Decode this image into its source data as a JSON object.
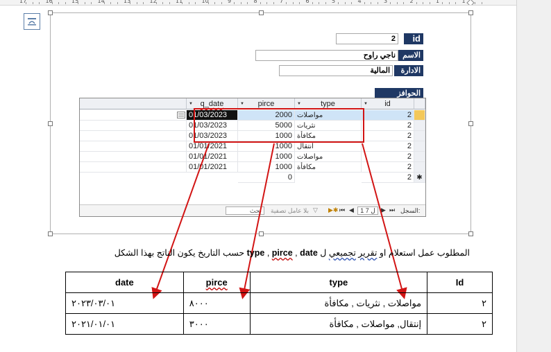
{
  "ruler": {
    "numbers": [
      "17",
      "16",
      "15",
      "14",
      "13",
      "12",
      "11",
      "10",
      "9",
      "8",
      "7",
      "6",
      "5",
      "4",
      "3",
      "2",
      "1",
      "1"
    ]
  },
  "icons": {
    "layout_options": "layout-options-icon",
    "datasheet_tools": "datasheet-button-icon"
  },
  "form": {
    "id_label": "id",
    "id_value": "2",
    "name_label": "الاسم",
    "name_value": "ناجي راوح",
    "dept_label": "الادارة",
    "dept_value": "المالية",
    "bonuses_label": "الحوافز"
  },
  "subform": {
    "columns": {
      "q_date": "q_date",
      "pirce": "pirce",
      "type": "type",
      "id": "id"
    },
    "rows": [
      {
        "q_date": "01/03/2023",
        "pirce": "2000",
        "type": "مواصلات",
        "id": "2"
      },
      {
        "q_date": "01/03/2023",
        "pirce": "5000",
        "type": "نثريات",
        "id": "2"
      },
      {
        "q_date": "01/03/2023",
        "pirce": "1000",
        "type": "مكافأة",
        "id": "2"
      },
      {
        "q_date": "01/01/2021",
        "pirce": "1000",
        "type": "انتقال",
        "id": "2"
      },
      {
        "q_date": "01/01/2021",
        "pirce": "1000",
        "type": "مواصلات",
        "id": "2"
      },
      {
        "q_date": "01/01/2021",
        "pirce": "1000",
        "type": "مكافأة",
        "id": "2"
      }
    ],
    "new_row": {
      "pirce": "0",
      "id": "2",
      "marker": "✱"
    },
    "navigation": {
      "record_label": "السجل:",
      "record_position": "1 ل 7",
      "no_filter_label": "بلا عامل تصفية",
      "search_placeholder": "بحث"
    }
  },
  "task_text": {
    "part1": "المطلوب عمل استعلام او ",
    "report": "تقرير",
    "part2": " ",
    "aggregate": "تجميعي",
    "part3": " ل  ",
    "type": "type",
    "comma1": " , ",
    "pirce": "pirce",
    "comma2": "  ,  ",
    "date": "date",
    "part4": "  حسب التاريخ  يكون الناتج بهذا الشكل"
  },
  "result_table": {
    "headers": {
      "date": "date",
      "pirce": "pirce",
      "type": "type",
      "id": "Id"
    },
    "rows": [
      {
        "date": "٢٠٢٣/٠٣/٠١",
        "pirce": "٨٠٠٠",
        "type": "مواصلات , نثريات , مكافأة",
        "id": "٢"
      },
      {
        "date": "٢٠٢١/٠١/٠١",
        "pirce": "٣٠٠٠",
        "type": "إنتقال, مواصلات , مكافأة",
        "id": "٢"
      }
    ]
  },
  "colors": {
    "label_background": "#1f3864",
    "highlight_row": "#cfe4f7",
    "annotation_red": "#d21414",
    "grid_header": "#eef0f4"
  }
}
